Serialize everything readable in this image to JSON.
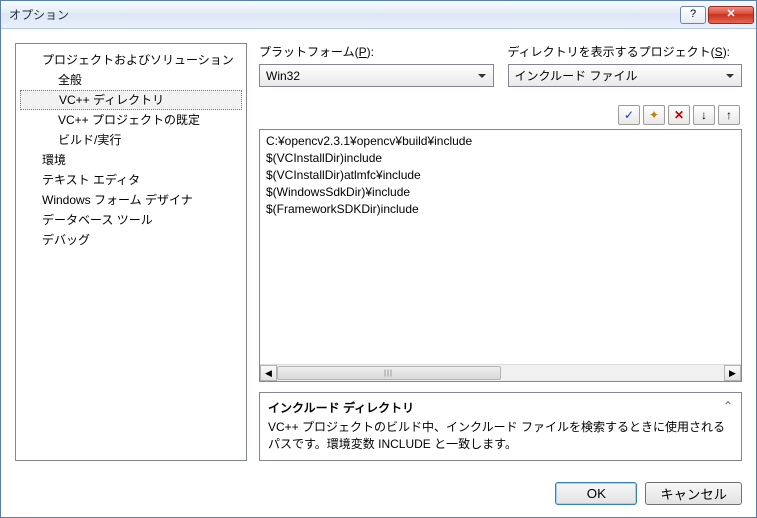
{
  "window": {
    "title": "オプション"
  },
  "tree": {
    "n0": "プロジェクトおよびソリューション",
    "n0a": "全般",
    "n0b": "VC++ ディレクトリ",
    "n0c": "VC++ プロジェクトの既定",
    "n0d": "ビルド/実行",
    "n1": "環境",
    "n2": "テキスト エディタ",
    "n3": "Windows フォーム デザイナ",
    "n4": "データベース ツール",
    "n5": "デバッグ"
  },
  "platform": {
    "label_pre": "プラットフォーム(",
    "key": "P",
    "label_post": "):",
    "value": "Win32"
  },
  "project": {
    "label_pre": "ディレクトリを表示するプロジェクト(",
    "key": "S",
    "label_post": "):",
    "value": "インクルード ファイル"
  },
  "toolbar_icons": {
    "check": "✓",
    "new": "✦",
    "delete": "✕",
    "down": "↓",
    "up": "↑"
  },
  "paths": [
    "C:¥opencv2.3.1¥opencv¥build¥include",
    "$(VCInstallDir)include",
    "$(VCInstallDir)atlmfc¥include",
    "$(WindowsSdkDir)¥include",
    "$(FrameworkSDKDir)include"
  ],
  "desc": {
    "title": "インクルード ディレクトリ",
    "body": "VC++ プロジェクトのビルド中、インクルード ファイルを検索するときに使用されるパスです。環境変数 INCLUDE と一致します。"
  },
  "buttons": {
    "ok": "OK",
    "cancel": "キャンセル"
  }
}
